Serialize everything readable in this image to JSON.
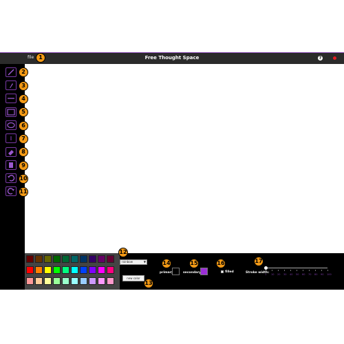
{
  "header": {
    "file_label": "file",
    "title": "Free Thought Space",
    "help_icon": "help-icon",
    "close_icon": "close-icon"
  },
  "tools": [
    {
      "name": "pencil",
      "icon": "pencil-icon"
    },
    {
      "name": "brush",
      "icon": "brush-icon"
    },
    {
      "name": "line",
      "icon": "line-icon"
    },
    {
      "name": "rectangle",
      "icon": "rectangle-icon"
    },
    {
      "name": "ellipse",
      "icon": "ellipse-icon"
    },
    {
      "name": "text",
      "icon": "text-icon"
    },
    {
      "name": "eraser",
      "icon": "eraser-icon"
    },
    {
      "name": "clear",
      "icon": "clear-icon"
    },
    {
      "name": "undo",
      "icon": "undo-icon"
    },
    {
      "name": "redo",
      "icon": "redo-icon"
    }
  ],
  "palette": {
    "rows": [
      [
        "#660000",
        "#663300",
        "#666600",
        "#006600",
        "#006633",
        "#006666",
        "#003366",
        "#330066",
        "#660066",
        "#660033"
      ],
      [
        "#ff0000",
        "#ff8000",
        "#ffff00",
        "#00ff00",
        "#00ff80",
        "#00ffff",
        "#0040ff",
        "#8000ff",
        "#ff00ff",
        "#ff0080"
      ],
      [
        "#ff9999",
        "#ffcc99",
        "#ffff99",
        "#99ff99",
        "#99ffcc",
        "#99ffff",
        "#99ccff",
        "#cc99ff",
        "#ff99ff",
        "#ff99cc"
      ]
    ]
  },
  "palette_select": {
    "value": "rainbow"
  },
  "new_color_button": "new color",
  "primary": {
    "label": "primary:",
    "color": "#000000"
  },
  "secondary": {
    "label": "secondary:",
    "color": "#9b2fd6"
  },
  "filled": {
    "label": "filled",
    "checked": false
  },
  "stroke": {
    "label": "Stroke width:",
    "value": 1,
    "ticks": [
      "1",
      "10",
      "20",
      "30",
      "40",
      "50",
      "60",
      "70",
      "80",
      "90",
      "100"
    ]
  },
  "annotations": [
    "1",
    "2",
    "3",
    "4",
    "5",
    "6",
    "7",
    "8",
    "9",
    "10",
    "11",
    "12",
    "13",
    "14",
    "15",
    "16",
    "17"
  ],
  "colors": {
    "accent": "#7a3aa6",
    "badge": "#f39a16",
    "close": "#e31b23"
  }
}
